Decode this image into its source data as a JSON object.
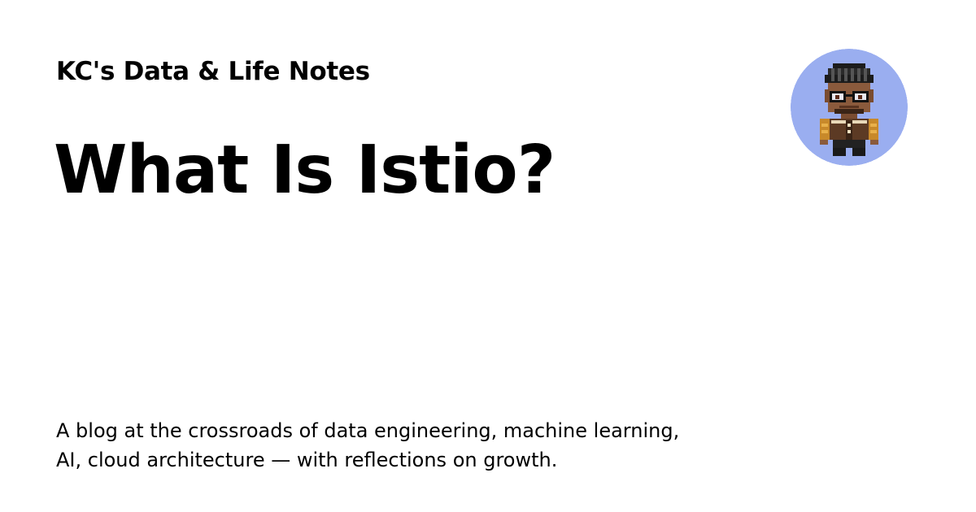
{
  "site": {
    "name": "KC's Data & Life Notes"
  },
  "post": {
    "title": "What Is Istio?"
  },
  "description": {
    "line1": "A blog at the crossroads of data engineering, machine learning,",
    "line2": "AI, cloud architecture — with reflections on growth."
  },
  "avatar": {
    "icon": "pixel-art-person-avatar-icon",
    "background_color": "#9aaef0"
  },
  "colors": {
    "background": "#ffffff",
    "text": "#000000"
  }
}
